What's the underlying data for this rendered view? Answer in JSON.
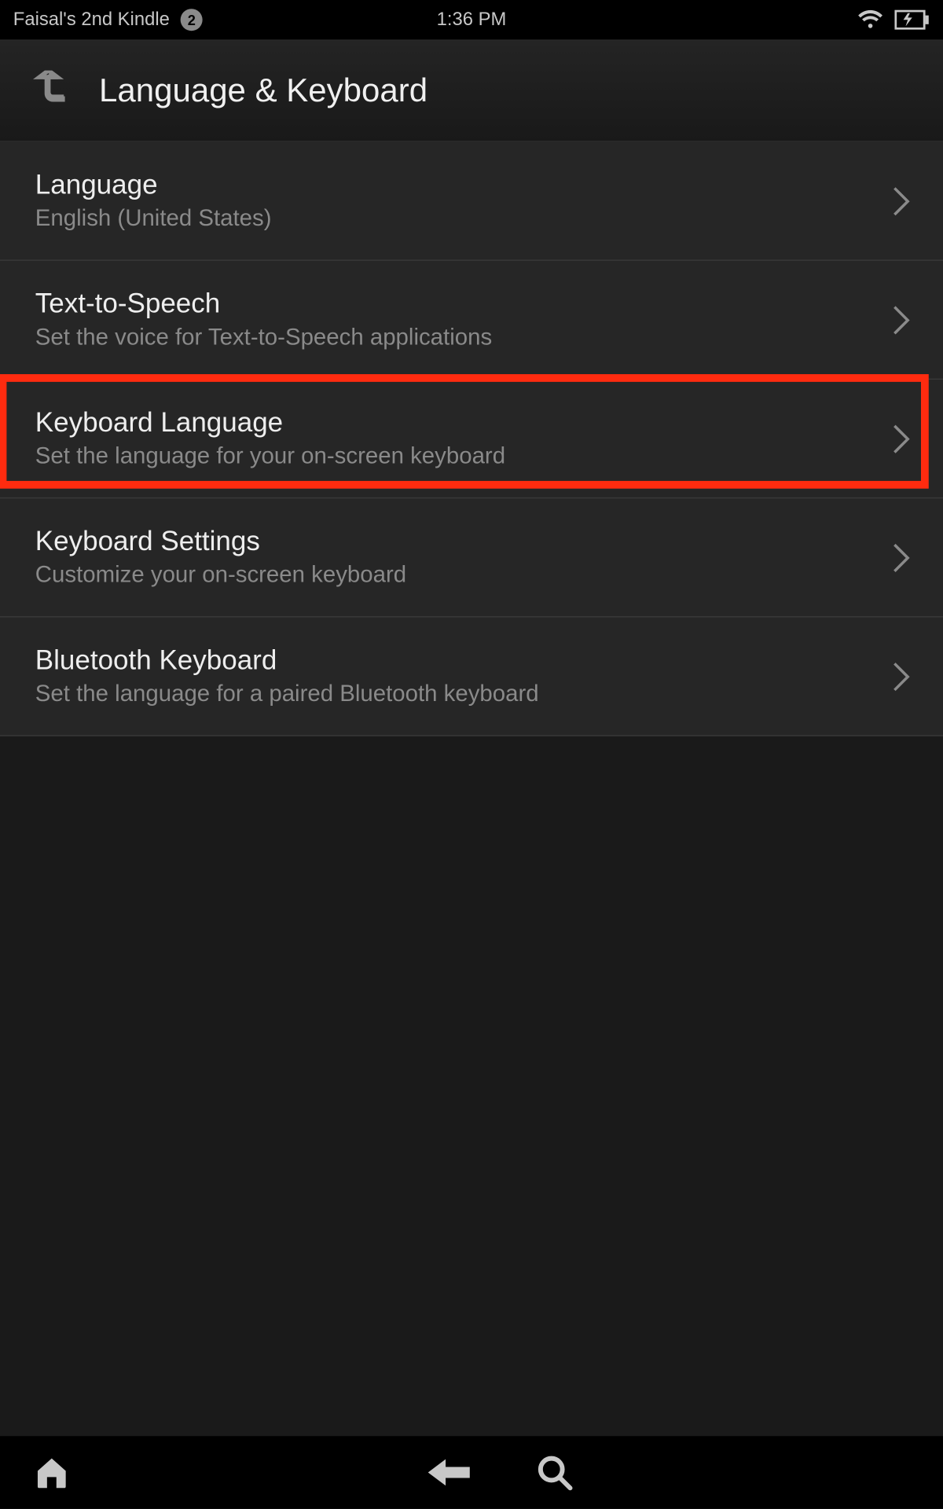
{
  "status": {
    "device_name": "Faisal's 2nd Kindle",
    "notification_count": "2",
    "time": "1:36 PM"
  },
  "header": {
    "title": "Language & Keyboard"
  },
  "list": {
    "items": [
      {
        "title": "Language",
        "sub": "English (United States)"
      },
      {
        "title": "Text-to-Speech",
        "sub": "Set the voice for Text-to-Speech applications"
      },
      {
        "title": "Keyboard Language",
        "sub": "Set the language for your on-screen keyboard"
      },
      {
        "title": "Keyboard Settings",
        "sub": "Customize your on-screen keyboard"
      },
      {
        "title": "Bluetooth Keyboard",
        "sub": "Set the language for a paired Bluetooth keyboard"
      }
    ],
    "highlighted_index": 2
  },
  "colors": {
    "highlight": "#ff2b0f",
    "background": "#262626",
    "text_primary": "#eeeeee",
    "text_secondary": "#8a8a8a"
  }
}
